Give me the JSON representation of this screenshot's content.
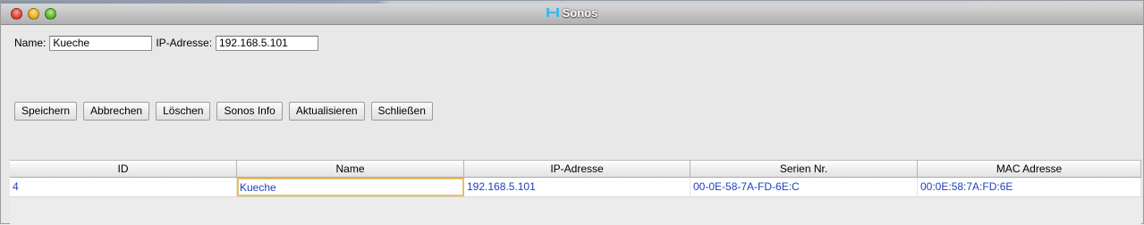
{
  "window": {
    "title": "Sonos",
    "icon": "sonos-app-icon"
  },
  "form": {
    "name_label": "Name:",
    "name_value": "Kueche",
    "ip_label": "IP-Adresse:",
    "ip_value": "192.168.5.101"
  },
  "buttons": {
    "save": "Speichern",
    "cancel": "Abbrechen",
    "delete": "Löschen",
    "info": "Sonos Info",
    "refresh": "Aktualisieren",
    "close": "Schließen"
  },
  "table": {
    "columns": [
      "ID",
      "Name",
      "IP-Adresse",
      "Serien Nr.",
      "MAC Adresse"
    ],
    "rows": [
      [
        "4",
        "Kueche",
        "192.168.5.101",
        "00-0E-58-7A-FD-6E:C",
        "00:0E:58:7A:FD:6E"
      ]
    ],
    "cell_text_color": "#1f3fbf",
    "focus_color": "#e9be63"
  }
}
